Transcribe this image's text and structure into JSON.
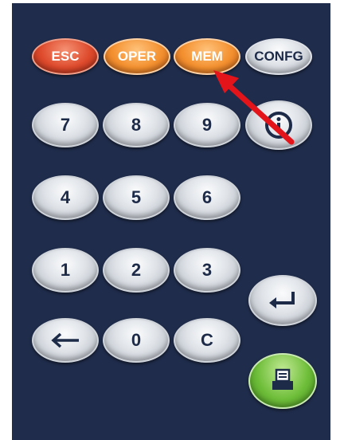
{
  "keypad": {
    "function_keys": {
      "esc": "ESC",
      "oper": "OPER",
      "mem": "MEM",
      "confg": "CONFG"
    },
    "digits": {
      "seven": "7",
      "eight": "8",
      "nine": "9",
      "four": "4",
      "five": "5",
      "six": "6",
      "one": "1",
      "two": "2",
      "three": "3",
      "zero": "0"
    },
    "clear": "C",
    "icons": {
      "info": "info-circle-icon",
      "backspace": "left-arrow-icon",
      "enter": "enter-return-icon",
      "print": "printer-icon"
    },
    "colors": {
      "background": "#1f2c4b",
      "esc": "#de4a2c",
      "orange": "#f3902f",
      "silver": "#dfe3e8",
      "print_green": "#6fbe3a",
      "annotation_arrow": "#e4141b"
    }
  }
}
